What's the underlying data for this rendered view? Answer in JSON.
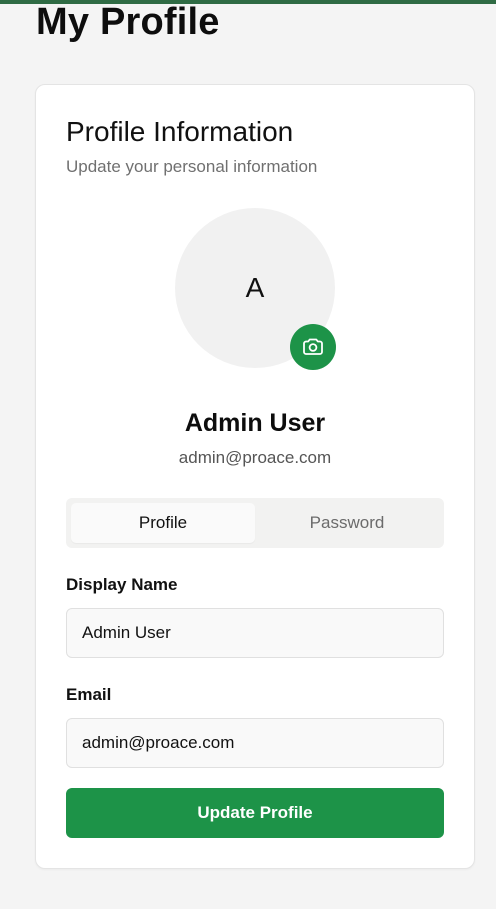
{
  "page": {
    "title": "My Profile"
  },
  "profile_card": {
    "title": "Profile Information",
    "subtitle": "Update your personal information",
    "avatar_initial": "A",
    "camera_icon": "camera-icon",
    "user_name": "Admin User",
    "user_email": "admin@proace.com"
  },
  "tabs": [
    {
      "label": "Profile",
      "active": true
    },
    {
      "label": "Password",
      "active": false
    }
  ],
  "form": {
    "display_name": {
      "label": "Display Name",
      "value": "Admin User"
    },
    "email": {
      "label": "Email",
      "value": "admin@proace.com"
    },
    "submit_label": "Update Profile"
  },
  "colors": {
    "accent_green": "#1d9348",
    "top_bar": "#2f6b44",
    "page_background": "#f4f4f4"
  }
}
